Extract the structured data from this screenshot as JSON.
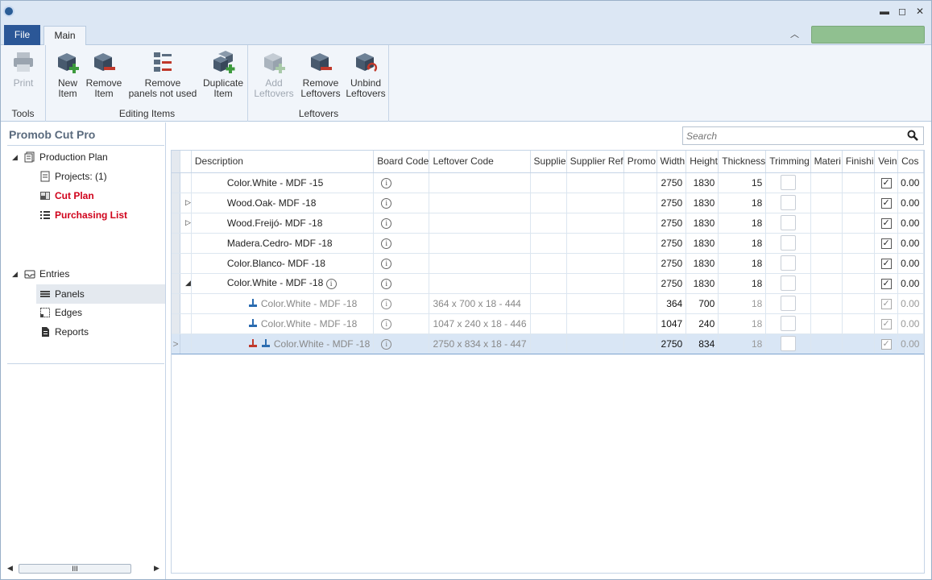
{
  "window": {
    "minimize": "▬",
    "restore": "◻",
    "close": "✕"
  },
  "ribbon_tabs": {
    "file": "File",
    "main": "Main",
    "collapse": "︿"
  },
  "ribbon": {
    "groups": [
      {
        "label": "Tools",
        "buttons": [
          {
            "line1": "Print",
            "line2": ""
          }
        ]
      },
      {
        "label": "Editing Items",
        "buttons": [
          {
            "line1": "New",
            "line2": "Item"
          },
          {
            "line1": "Remove",
            "line2": "Item"
          },
          {
            "line1": "Remove",
            "line2": "panels not used"
          },
          {
            "line1": "Duplicate",
            "line2": "Item"
          }
        ]
      },
      {
        "label": "Leftovers",
        "buttons": [
          {
            "line1": "Add",
            "line2": "Leftovers"
          },
          {
            "line1": "Remove",
            "line2": "Leftovers"
          },
          {
            "line1": "Unbind",
            "line2": "Leftovers"
          }
        ]
      }
    ]
  },
  "sidebar": {
    "title": "Promob Cut Pro",
    "production": {
      "label": "Production Plan",
      "projects": "Projects: (1)",
      "cut_plan": "Cut Plan",
      "purchasing": "Purchasing List"
    },
    "entries": {
      "label": "Entries",
      "panels": "Panels",
      "edges": "Edges",
      "reports": "Reports"
    },
    "scroll_thumb": "III"
  },
  "search": {
    "placeholder": "Search"
  },
  "table": {
    "columns": [
      "Description",
      "Board Code",
      "Leftover Code",
      "Supplie",
      "Supplier Ref",
      "Promo",
      "Width",
      "Height",
      "Thickness",
      "Trimming",
      "Materi",
      "Finishi",
      "Vein",
      "Cos"
    ],
    "rows": [
      {
        "description": "Color.White - MDF -15",
        "leftover": "",
        "width": "2750",
        "height": "1830",
        "thickness": "15",
        "cost": "0.00",
        "expander": ""
      },
      {
        "description": "Wood.Oak- MDF -18",
        "leftover": "",
        "width": "2750",
        "height": "1830",
        "thickness": "18",
        "cost": "0.00",
        "expander": "▷"
      },
      {
        "description": "Wood.Freijó- MDF -18",
        "leftover": "",
        "width": "2750",
        "height": "1830",
        "thickness": "18",
        "cost": "0.00",
        "expander": "▷"
      },
      {
        "description": "Madera.Cedro- MDF -18",
        "leftover": "",
        "width": "2750",
        "height": "1830",
        "thickness": "18",
        "cost": "0.00",
        "expander": ""
      },
      {
        "description": "Color.Blanco- MDF -18",
        "leftover": "",
        "width": "2750",
        "height": "1830",
        "thickness": "18",
        "cost": "0.00",
        "expander": ""
      },
      {
        "description": "Color.White - MDF -18",
        "leftover": "",
        "width": "2750",
        "height": "1830",
        "thickness": "18",
        "cost": "0.00",
        "expander": "◢"
      },
      {
        "description": "Color.White - MDF -18",
        "leftover": "364 x 700 x 18 - 444",
        "width": "364",
        "height": "700",
        "thickness": "18",
        "cost": "0.00",
        "expander": ""
      },
      {
        "description": "Color.White - MDF -18",
        "leftover": "1047 x 240 x 18 - 446",
        "width": "1047",
        "height": "240",
        "thickness": "18",
        "cost": "0.00",
        "expander": ""
      },
      {
        "description": "Color.White - MDF -18",
        "leftover": "2750 x 834 x 18 - 447",
        "width": "2750",
        "height": "834",
        "thickness": "18",
        "cost": "0.00",
        "expander": ""
      }
    ],
    "current_row_marker": ">",
    "info_glyph": "i",
    "check_glyph": "✓"
  },
  "colors": {
    "accent": "#2b5797",
    "red_item": "#d0021b",
    "status_green": "#90c090"
  }
}
